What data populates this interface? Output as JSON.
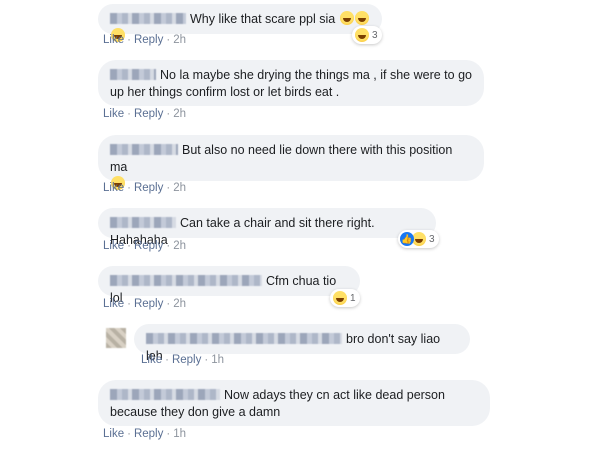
{
  "actions": {
    "like": "Like",
    "reply": "Reply",
    "sep": "·"
  },
  "comments": [
    {
      "text": "Why like that scare ppl sia",
      "time": "2h",
      "reaction_count": "3"
    },
    {
      "text": "No la maybe she drying the things ma , if she were to go up her things confirm lost or let birds eat .",
      "time": "2h"
    },
    {
      "text": "But also no need lie down there with this position ma",
      "time": "2h"
    },
    {
      "text": "Can take a chair and sit there right. Hahahaha",
      "time": "2h",
      "reaction_count": "3"
    },
    {
      "text": "Cfm chua tio lol",
      "time": "2h",
      "reaction_count": "1"
    },
    {
      "text": "bro don't say liao leh",
      "time": "1h"
    },
    {
      "text": "Now adays they cn act like dead person because they don give a damn",
      "time": "1h"
    }
  ],
  "icons": {
    "laugh": "laughing-emoji",
    "like": "thumbs-up",
    "accent": "#5a6f93",
    "bubble_bg": "#f0f2f5"
  }
}
